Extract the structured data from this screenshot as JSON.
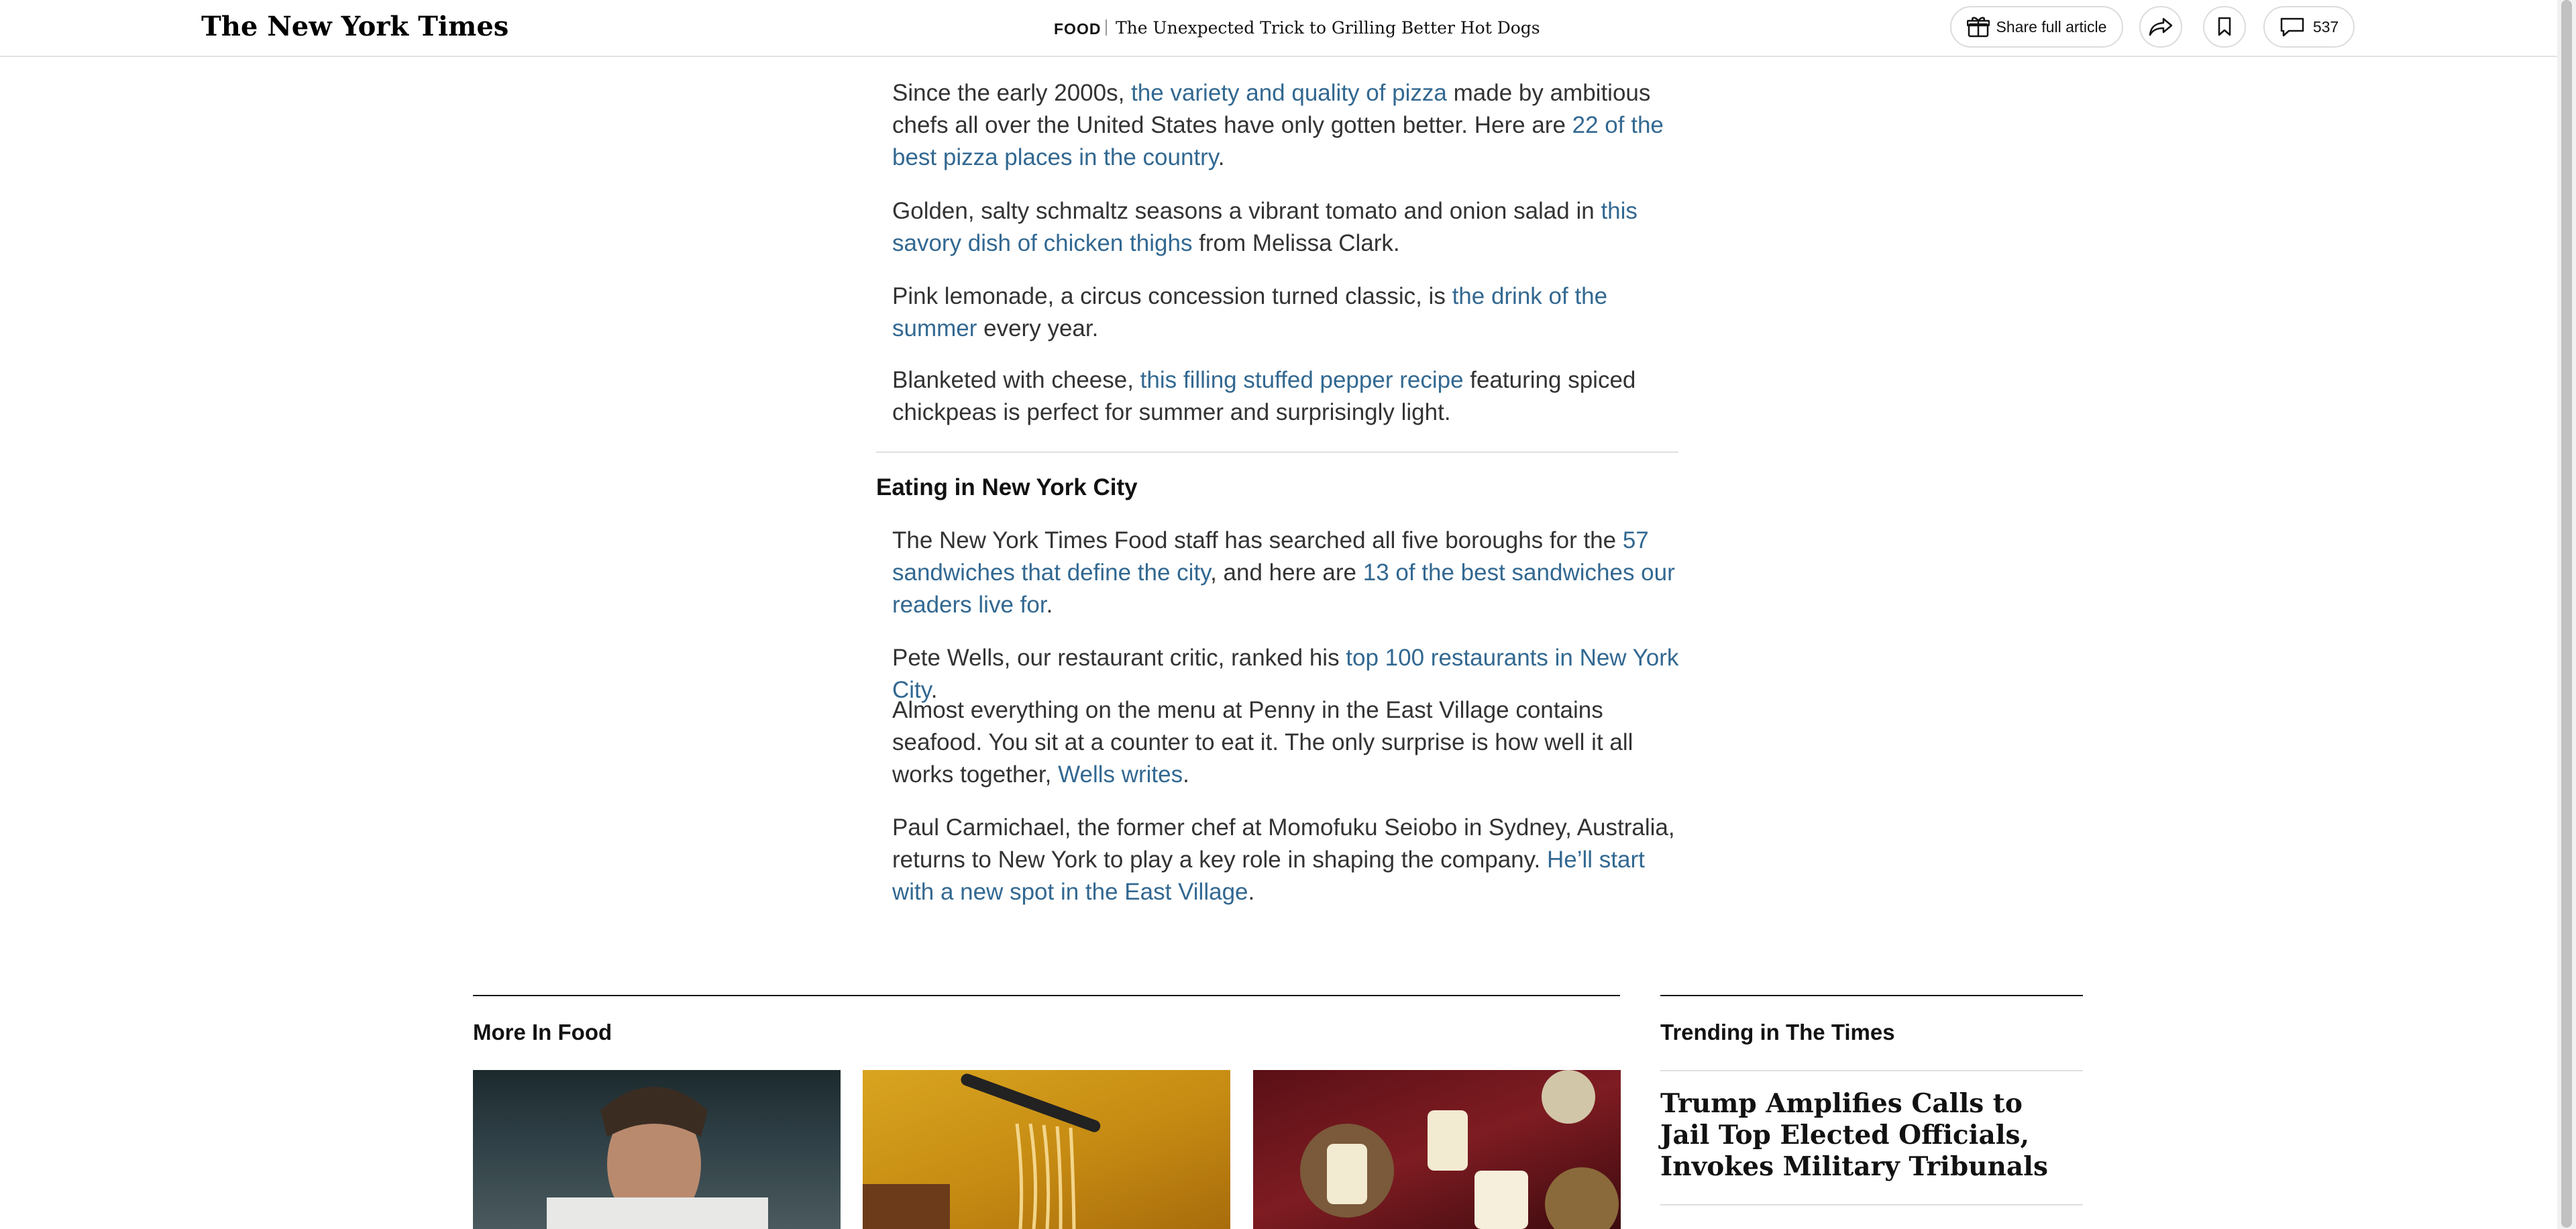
{
  "header": {
    "logo_text": "The New York Times",
    "section": "FOOD",
    "headline": "The Unexpected Trick to Grilling Better Hot Dogs",
    "share_label": "Share full article",
    "comment_count": "537"
  },
  "article": {
    "paragraphs": [
      {
        "segments": [
          {
            "text": "Since the early 2000s, ",
            "link": false
          },
          {
            "text": "the variety and quality of pizza",
            "link": true
          },
          {
            "text": " made by ambitious chefs all over the United States have only gotten better. Here are ",
            "link": false
          },
          {
            "text": "22 of the best pizza places in the country",
            "link": true
          },
          {
            "text": ".",
            "link": false
          }
        ]
      },
      {
        "segments": [
          {
            "text": "Golden, salty schmaltz seasons a vibrant tomato and onion salad in ",
            "link": false
          },
          {
            "text": "this savory dish of chicken thighs",
            "link": true
          },
          {
            "text": " from Melissa Clark.",
            "link": false
          }
        ]
      },
      {
        "segments": [
          {
            "text": "Pink lemonade, a circus concession turned classic, is ",
            "link": false
          },
          {
            "text": "the drink of the summer",
            "link": true
          },
          {
            "text": " every year.",
            "link": false
          }
        ]
      },
      {
        "segments": [
          {
            "text": "Blanketed with cheese, ",
            "link": false
          },
          {
            "text": "this filling stuffed pepper recipe",
            "link": true
          },
          {
            "text": " featuring spiced chickpeas is perfect for summer and surprisingly light.",
            "link": false
          }
        ]
      }
    ],
    "subhead": "Eating in New York City",
    "paragraphs2": [
      {
        "segments": [
          {
            "text": "The New York Times Food staff has searched all five boroughs for the ",
            "link": false
          },
          {
            "text": "57 sandwiches that define the city",
            "link": true
          },
          {
            "text": ", and here are ",
            "link": false
          },
          {
            "text": "13 of the best sandwiches our readers live for",
            "link": true
          },
          {
            "text": ".",
            "link": false
          }
        ]
      },
      {
        "segments": [
          {
            "text": "Pete Wells, our restaurant critic, ranked his ",
            "link": false
          },
          {
            "text": "top 100 restaurants in New York City",
            "link": true
          },
          {
            "text": ".",
            "link": false
          }
        ]
      },
      {
        "segments": [
          {
            "text": "Almost everything on the menu at Penny in the East Village contains seafood. You sit at a counter to eat it. The only surprise is how well it all works together, ",
            "link": false
          },
          {
            "text": "Wells writes",
            "link": true
          },
          {
            "text": ".",
            "link": false
          }
        ]
      },
      {
        "segments": [
          {
            "text": "Paul Carmichael, the former chef at Momofuku Seiobo in Sydney, Australia, returns to New York to play a key role in shaping the company. ",
            "link": false
          },
          {
            "text": "He’ll start with a new spot in the East Village",
            "link": true
          },
          {
            "text": ".",
            "link": false
          }
        ]
      }
    ]
  },
  "more": {
    "label": "More In Food"
  },
  "trending": {
    "label": "Trending in The Times",
    "headline": "Trump Amplifies Calls to Jail Top Elected Officials, Invokes Military Tribunals"
  },
  "colors": {
    "link": "#326891",
    "body_text": "#333333"
  }
}
